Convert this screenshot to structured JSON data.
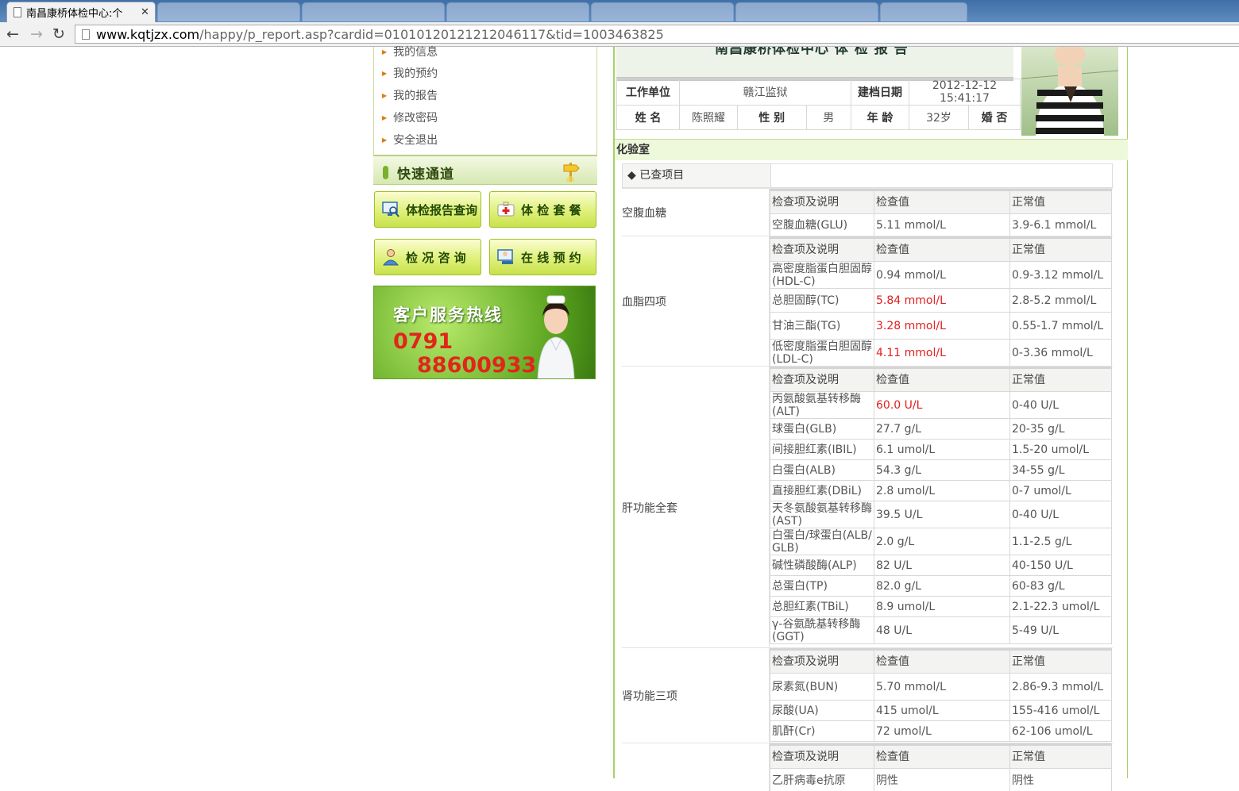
{
  "browser": {
    "active_tab_title": "南昌康桥体检中心:个",
    "other_tabs": [
      "",
      "",
      "",
      "",
      "",
      ""
    ],
    "url_host": "www.kqtjzx.com",
    "url_path": "/happy/p_report.asp?cardid=01010120121212046117&tid=1003463825"
  },
  "sidebar": {
    "menu_items": [
      "我的信息",
      "我的预约",
      "我的报告",
      "修改密码",
      "安全退出"
    ],
    "quick_title": "快速通道",
    "quick_buttons": [
      "体检报告查询",
      "体 检 套 餐",
      "检 况 咨 询",
      "在 线 预 约"
    ],
    "hotline_title": "客户服务热线",
    "hotline_area": "0791",
    "hotline_number": "88600933"
  },
  "report": {
    "title": "南昌康桥体检中心 体 检 报 告",
    "info": {
      "work_unit_label": "工作单位",
      "work_unit": "赣江监狱",
      "file_date_label": "建档日期",
      "file_date": "2012-12-12",
      "file_time": "15:41:17",
      "name_label": "姓 名",
      "name": "陈照耀",
      "gender_label": "性 别",
      "gender": "男",
      "age_label": "年 龄",
      "age": "32岁",
      "marital_label": "婚 否",
      "marital": ""
    },
    "section": "化验室",
    "checked_label": "◆ 已查项目",
    "col_item": "检查项及说明",
    "col_value": "检查值",
    "col_normal": "正常值",
    "groups": [
      {
        "name": "空腹血糖",
        "rows": [
          {
            "item": "空腹血糖(GLU)",
            "value": "5.11  mmol/L",
            "normal": "3.9-6.1   mmol/L",
            "abnormal": false
          }
        ]
      },
      {
        "name": "血脂四项",
        "rows": [
          {
            "item": "高密度脂蛋白胆固醇(HDL-C)",
            "value": "0.94  mmol/L",
            "normal": "0.9-3.12   mmol/L",
            "abnormal": false
          },
          {
            "item": "总胆固醇(TC)",
            "value": "5.84  mmol/L",
            "normal": "2.8-5.2   mmol/L",
            "abnormal": true
          },
          {
            "item": "甘油三酯(TG)",
            "value": "3.28  mmol/L",
            "normal": "0.55-1.7   mmol/L",
            "abnormal": true
          },
          {
            "item": "低密度脂蛋白胆固醇(LDL-C)",
            "value": "4.11  mmol/L",
            "normal": "0-3.36   mmol/L",
            "abnormal": true
          }
        ]
      },
      {
        "name": "肝功能全套",
        "rows": [
          {
            "item": "丙氨酸氨基转移酶(ALT)",
            "value": "60.0  U/L",
            "normal": "0-40   U/L",
            "abnormal": true
          },
          {
            "item": "球蛋白(GLB)",
            "value": "27.7  g/L",
            "normal": "20-35   g/L",
            "abnormal": false
          },
          {
            "item": "间接胆红素(IBIL)",
            "value": "6.1  umol/L",
            "normal": "1.5-20   umol/L",
            "abnormal": false
          },
          {
            "item": "白蛋白(ALB)",
            "value": "54.3  g/L",
            "normal": "34-55   g/L",
            "abnormal": false
          },
          {
            "item": "直接胆红素(DBiL)",
            "value": "2.8  umol/L",
            "normal": "0-7   umol/L",
            "abnormal": false
          },
          {
            "item": "天冬氨酸氨基转移酶(AST)",
            "value": "39.5  U/L",
            "normal": "0-40   U/L",
            "abnormal": false
          },
          {
            "item": "白蛋白/球蛋白(ALB/GLB)",
            "value": "2.0  g/L",
            "normal": "1.1-2.5   g/L",
            "abnormal": false
          },
          {
            "item": "碱性磷酸酶(ALP)",
            "value": "82  U/L",
            "normal": "40-150   U/L",
            "abnormal": false
          },
          {
            "item": "总蛋白(TP)",
            "value": "82.0  g/L",
            "normal": "60-83   g/L",
            "abnormal": false
          },
          {
            "item": "总胆红素(TBiL)",
            "value": "8.9  umol/L",
            "normal": "2.1-22.3   umol/L",
            "abnormal": false
          },
          {
            "item": "γ-谷氨酰基转移酶(GGT)",
            "value": "48  U/L",
            "normal": "5-49   U/L",
            "abnormal": false
          }
        ]
      },
      {
        "name": "肾功能三项",
        "rows": [
          {
            "item": "尿素氮(BUN)",
            "value": "5.70  mmol/L",
            "normal": "2.86-9.3   mmol/L",
            "abnormal": false
          },
          {
            "item": "尿酸(UA)",
            "value": "415  umol/L",
            "normal": "155-416   umol/L",
            "abnormal": false
          },
          {
            "item": "肌酐(Cr)",
            "value": "72  umol/L",
            "normal": "62-106   umol/L",
            "abnormal": false
          }
        ]
      },
      {
        "name": "",
        "rows": [
          {
            "item": "乙肝病毒e抗原",
            "value": "阴性",
            "normal": "阴性",
            "abnormal": false
          }
        ]
      }
    ]
  }
}
